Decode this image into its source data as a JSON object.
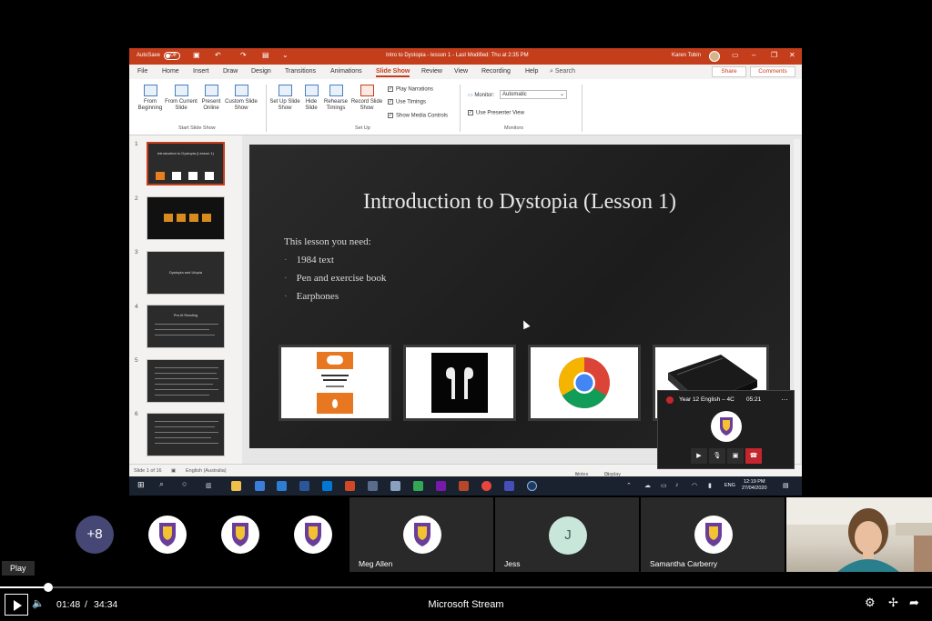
{
  "screen": {
    "titlebar": {
      "autosave_label": "AutoSave",
      "autosave_state": "Off",
      "doc_title": "Intro to Dystopia - lesson 1  -  Last Modified: Thu at 2:35 PM",
      "user_name": "Karen Tobin"
    },
    "menu": {
      "tabs": [
        "File",
        "Home",
        "Insert",
        "Draw",
        "Design",
        "Transitions",
        "Animations",
        "Slide Show",
        "Review",
        "View",
        "Recording",
        "Help"
      ],
      "active_tab": "Slide Show",
      "search_label": "Search",
      "share_label": "Share",
      "comments_label": "Comments"
    },
    "ribbon": {
      "from_beginning": "From Beginning",
      "from_current": "From Current Slide",
      "present_online": "Present Online",
      "custom_show": "Custom Slide Show",
      "group_start": "Start Slide Show",
      "setup_show": "Set Up Slide Show",
      "hide_slide": "Hide Slide",
      "rehearse": "Rehearse Timings",
      "record": "Record Slide Show",
      "play_narrations": "Play Narrations",
      "use_timings": "Use Timings",
      "show_media": "Show Media Controls",
      "group_setup": "Set Up",
      "monitor_label": "Monitor:",
      "monitor_value": "Automatic",
      "presenter_view": "Use Presenter View",
      "group_monitors": "Monitors"
    },
    "thumbnails": [
      {
        "num": "1",
        "title": "Introduction to Dystopia (Lesson 1)"
      },
      {
        "num": "2",
        "title": ""
      },
      {
        "num": "3",
        "title": "Dystopia and Utopia"
      },
      {
        "num": "4",
        "title": "Pre-lit Reading"
      },
      {
        "num": "5",
        "title": ""
      },
      {
        "num": "6",
        "title": ""
      }
    ],
    "slide": {
      "title": "Introduction to Dystopia (Lesson 1)",
      "intro": "This lesson you need:",
      "bullets": [
        "1984 text",
        "Pen and exercise book",
        "Earphones"
      ],
      "images": [
        "penguin-book-cover",
        "airpods",
        "chrome-logo",
        "black-notebook"
      ]
    },
    "status": {
      "slide_count": "Slide 1 of 16",
      "language": "English (Australia)",
      "notes": "Notes",
      "display_settings": "Display Settings"
    },
    "taskbar": {
      "language": "ENG",
      "time": "12:19 PM",
      "date": "27/04/2020"
    }
  },
  "mini_call": {
    "meeting_name": "Year 12 English – 4C",
    "duration": "05:21"
  },
  "participants": {
    "overflow_count": "+8",
    "named": [
      {
        "name": "Meg Allen"
      },
      {
        "name": "Jess",
        "initial": "J"
      },
      {
        "name": "Samantha Carberry"
      }
    ]
  },
  "player": {
    "tooltip": "Play",
    "current_time": "01:48",
    "separator": "/",
    "total_time": "34:34",
    "progress": 0.052,
    "brand": "Microsoft Stream"
  },
  "colors": {
    "powerpoint_accent": "#c43e1c",
    "teams_purple": "#464775",
    "hangup_red": "#c4262e"
  }
}
